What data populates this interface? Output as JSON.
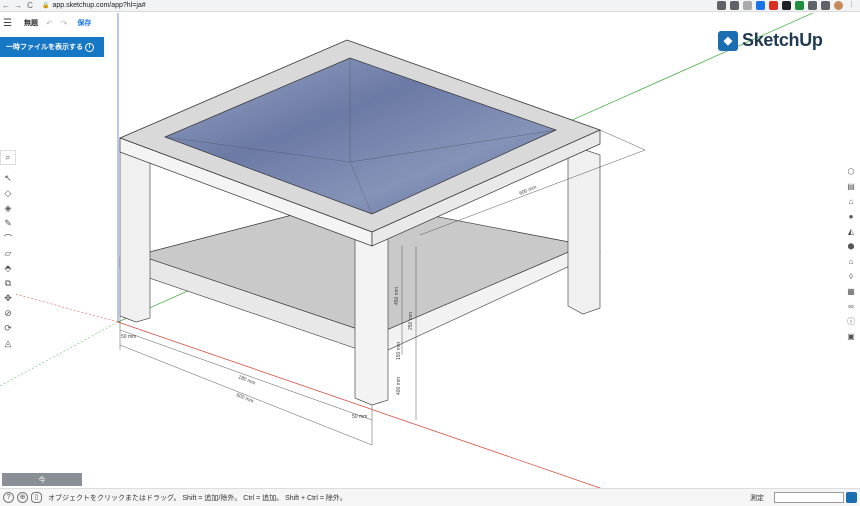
{
  "browser": {
    "url": "app.sketchup.com/app?hl=ja#",
    "back": "←",
    "forward": "→",
    "reload": "C"
  },
  "toolbar": {
    "menu_icon": "☰",
    "title": "無題",
    "undo": "↶",
    "redo": "↷",
    "save_label": "保存"
  },
  "temp_file": {
    "label": "一時ファイルを表示する",
    "info": "i"
  },
  "logo": {
    "name": "SketchUp"
  },
  "scene": {
    "label": "今"
  },
  "status": {
    "hint": "オブジェクトをクリックまたはドラッグ。 Shift = 追加/除外。 Ctrl = 追加。 Shift + Ctrl = 除外。",
    "measure_label": "測定",
    "measure_value": ""
  },
  "dimensions": {
    "d1": "180 mm",
    "d2": "600 mm",
    "d3": "50 mm",
    "d4": "50 mm",
    "d5": "600 mm",
    "d6": "450 mm",
    "d7": "250 mm",
    "d8": "400 mm",
    "d9": "150 mm"
  },
  "colors": {
    "accent": "#1677c4",
    "brand": "#1b6fb0",
    "axis_red": "#d23b2f",
    "axis_green": "#3aa93a",
    "axis_blue": "#3b5bd9"
  }
}
